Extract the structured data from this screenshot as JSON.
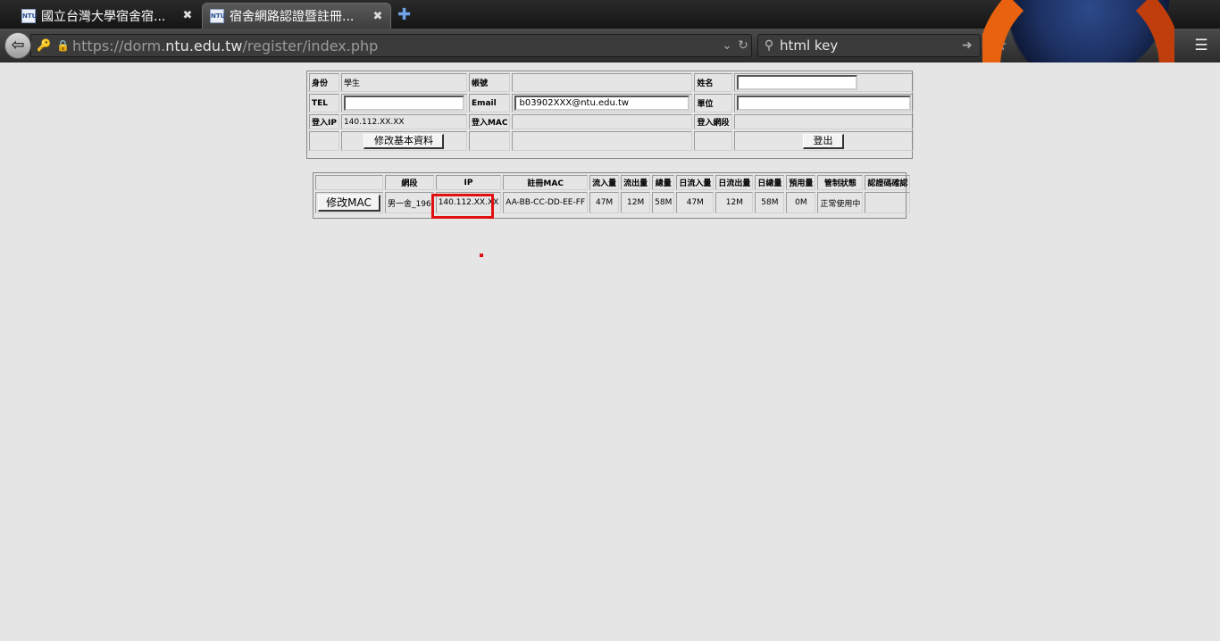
{
  "browser": {
    "tabs": [
      {
        "title": "國立台灣大學宿舍宿...",
        "favicon": "NTU"
      },
      {
        "title": "宿舍網路認證暨註冊...",
        "favicon": "NTU"
      }
    ],
    "new_tab_glyph": "✚",
    "url": {
      "prefix": "https://dorm.",
      "host": "ntu.edu.tw",
      "path": "/register/index.php"
    },
    "search_query": "html key",
    "toolbar_icons": [
      "star-icon",
      "reading-list-icon",
      "pocket-icon",
      "download-icon",
      "home-icon",
      "smiley-icon",
      "menu-icon"
    ]
  },
  "profile": {
    "identity_label": "身份",
    "identity_value": "學生",
    "account_label": "帳號",
    "account_value": "",
    "name_label": "姓名",
    "name_value": "",
    "tel_label": "TEL",
    "tel_value": "",
    "email_label": "Email",
    "email_value": "b03902XXX@ntu.edu.tw",
    "unit_label": "單位",
    "unit_value": "",
    "login_ip_label": "登入IP",
    "login_ip_value": "140.112.XX.XX",
    "login_mac_label": "登入MAC",
    "login_mac_value": "",
    "login_segment_label": "登入網段",
    "login_segment_value": "",
    "edit_button": "修改基本資料",
    "logout_button": "登出"
  },
  "mac_table": {
    "headers": [
      "",
      "網段",
      "IP",
      "註冊MAC",
      "流入量",
      "流出量",
      "總量",
      "日流入量",
      "日流出量",
      "日總量",
      "預用量",
      "管制狀態",
      "認證碼確認"
    ],
    "row": {
      "edit_button": "修改MAC",
      "segment": "男一舍_196",
      "ip": "140.112.XX.XX",
      "mac": "AA-BB-CC-DD-EE-FF",
      "in": "47M",
      "out": "12M",
      "total": "58M",
      "day_in": "47M",
      "day_out": "12M",
      "day_total": "58M",
      "reserved": "0M",
      "status": "正常使用中",
      "auth": ""
    }
  },
  "colors": {
    "highlight": "#e01010",
    "page_bg": "#e5e5e5"
  }
}
